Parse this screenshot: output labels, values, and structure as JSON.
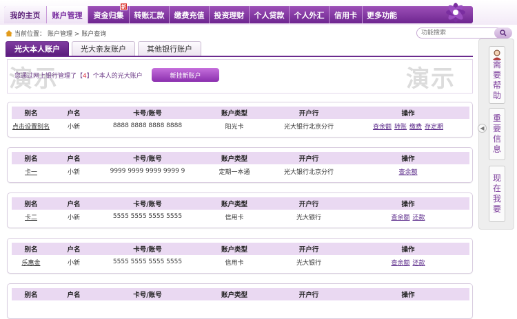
{
  "nav": {
    "items": [
      "我的主页",
      "账户管理",
      "资金归集",
      "转账汇款",
      "缴费充值",
      "投资理财",
      "个人贷款",
      "个人外汇",
      "信用卡",
      "更多功能"
    ],
    "badge": "新"
  },
  "breadcrumb": {
    "prefix": "当前位置：",
    "path": "账户管理 > 账户查询"
  },
  "search": {
    "placeholder": "功能搜索"
  },
  "tabs": [
    "光大本人账户",
    "光大亲友账户",
    "其他银行账户"
  ],
  "info": {
    "text_before": "您通过网上银行管理了【",
    "count": "4",
    "text_after": "】个本人的光大账户",
    "add_button": "新挂新账户",
    "watermark": "演示"
  },
  "table_headers": [
    "别名",
    "户名",
    "卡号/账号",
    "账户类型",
    "开户行",
    "操作"
  ],
  "accounts": [
    {
      "alias": "点击设置别名",
      "name": "小新",
      "number": "8888 8888 8888 8888",
      "type": "阳光卡",
      "bank": "光大银行北京分行",
      "ops": [
        "查余额",
        "转账",
        "缴费",
        "存定期"
      ]
    },
    {
      "alias": "卡一",
      "name": "小新",
      "number": "9999 9999 9999 9999 9",
      "type": "定期一本通",
      "bank": "光大银行北京分行",
      "ops": [
        "查余额"
      ]
    },
    {
      "alias": "卡二",
      "name": "小新",
      "number": "5555 5555 5555 5555",
      "type": "信用卡",
      "bank": "光大银行",
      "ops": [
        "查余额",
        "还款"
      ]
    },
    {
      "alias": "乐惠金",
      "name": "小新",
      "number": "5555 5555 5555 5555",
      "type": "信用卡",
      "bank": "光大银行",
      "ops": [
        "查余额",
        "还款"
      ]
    }
  ],
  "sidebar": {
    "buttons": [
      [
        "需",
        "要",
        "帮",
        "助"
      ],
      [
        "重",
        "要",
        "信",
        "息"
      ],
      [
        "现",
        "在",
        "我",
        "要"
      ]
    ]
  }
}
